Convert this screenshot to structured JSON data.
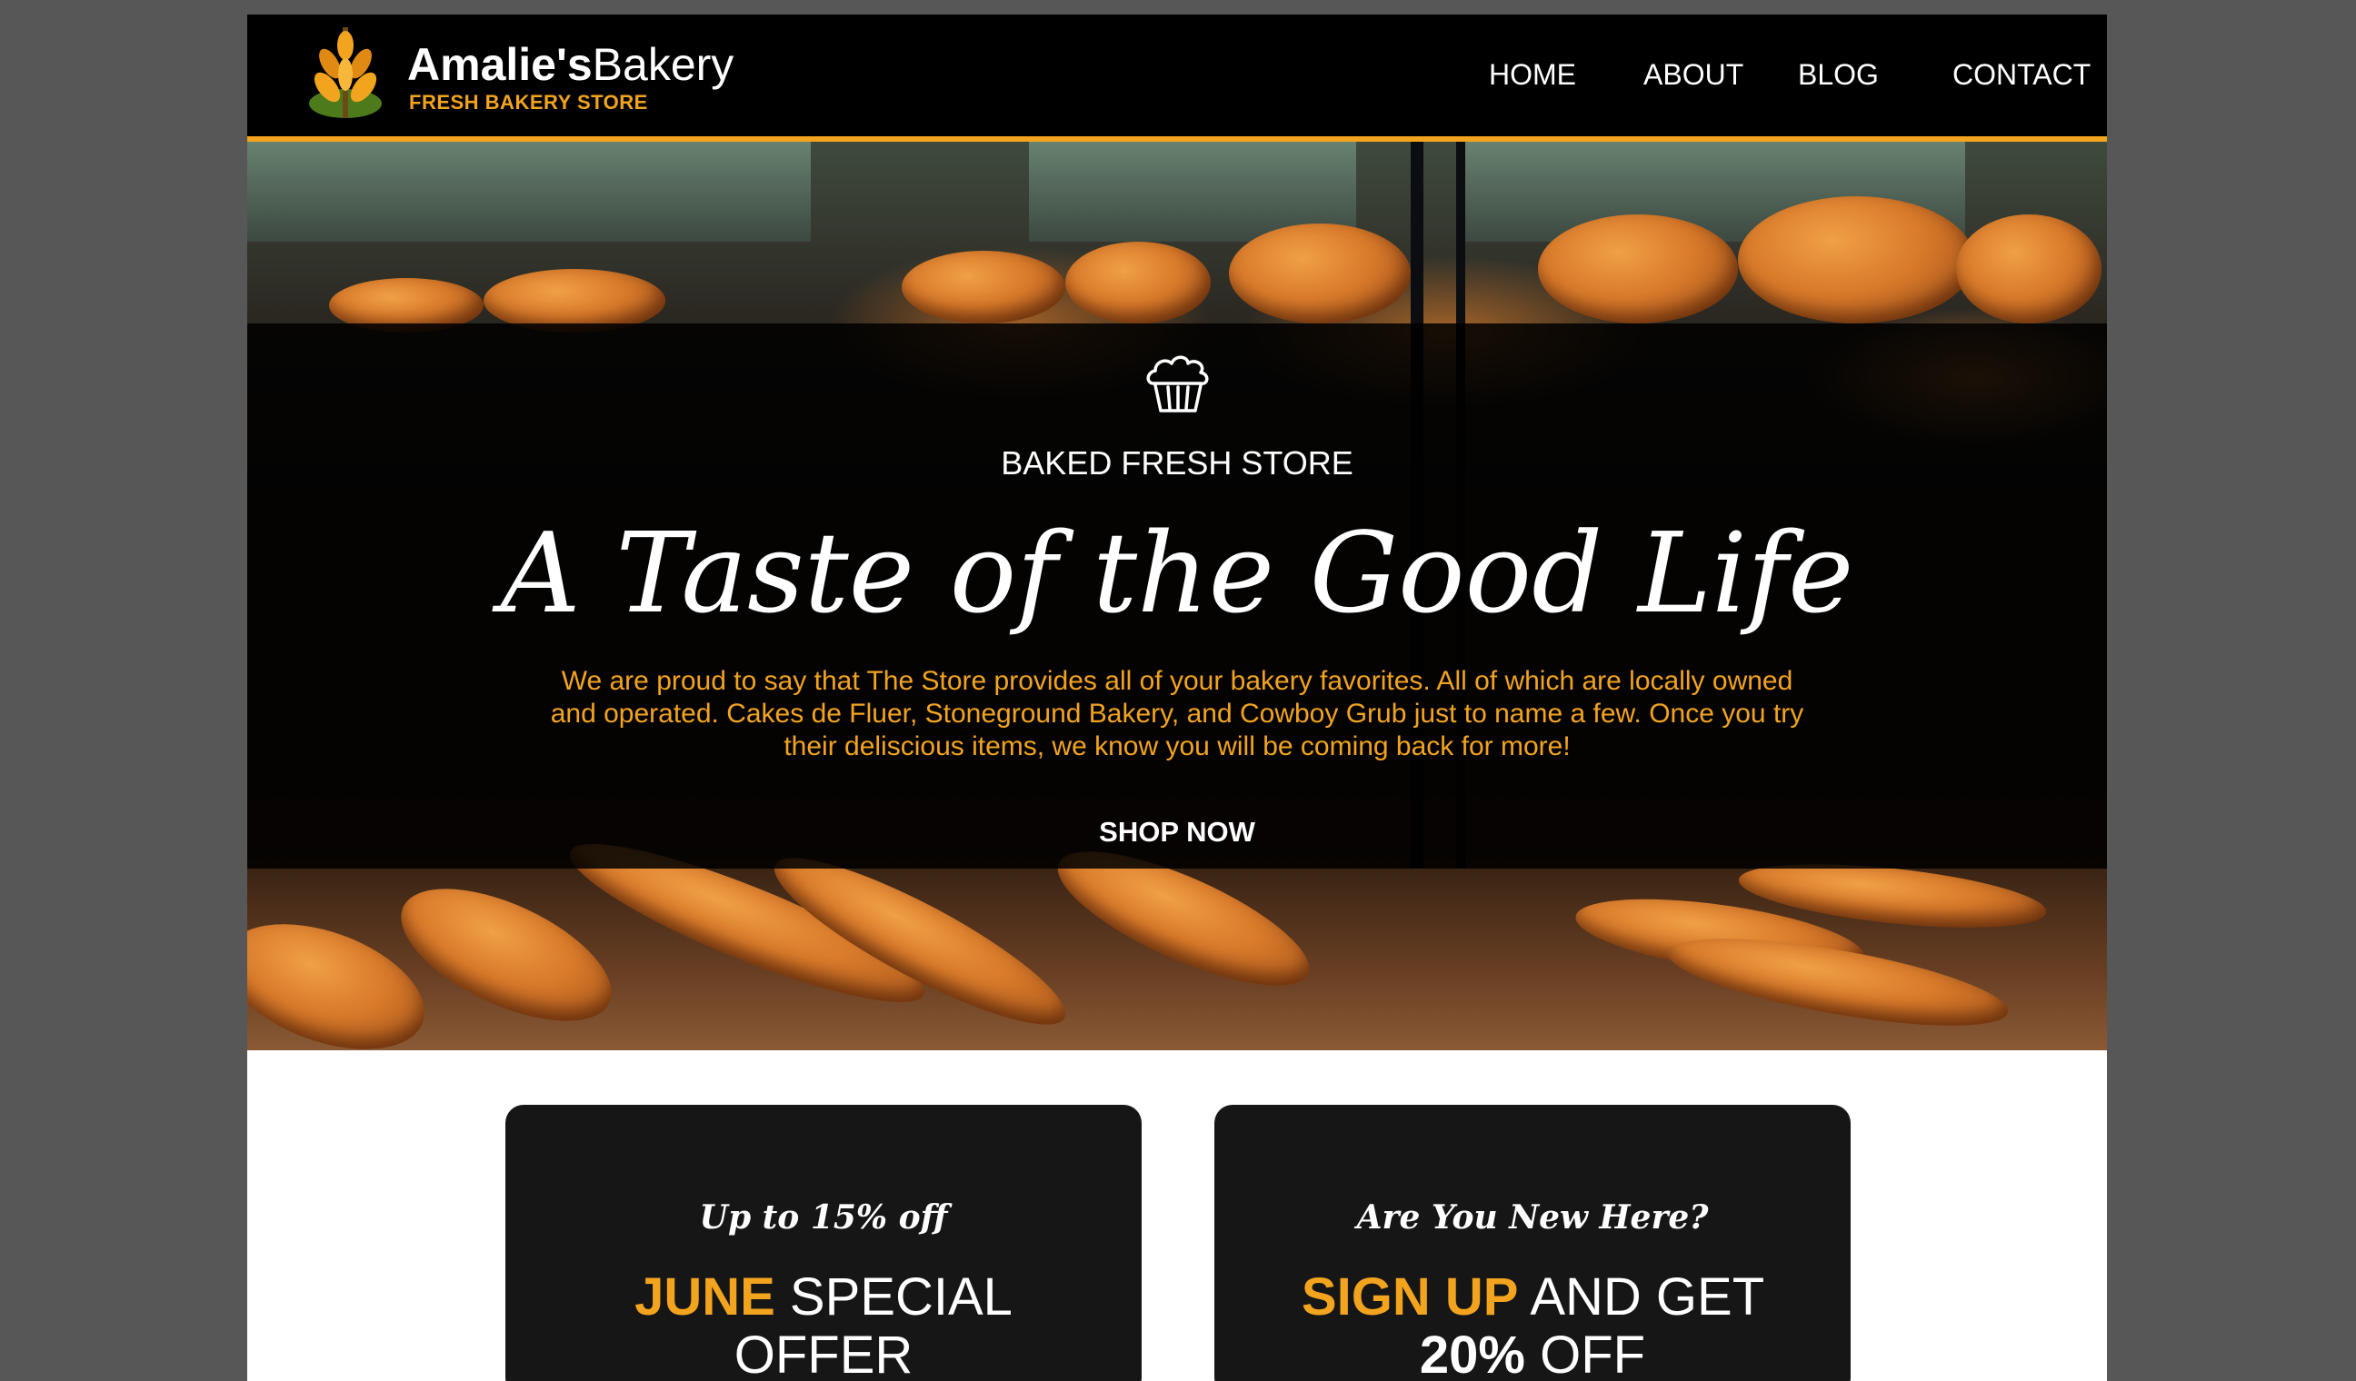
{
  "brand": {
    "name_bold": "Amalie's",
    "name_regular": "Bakery",
    "tagline": "FRESH BAKERY STORE",
    "logo_icon": "wheat-icon"
  },
  "nav": {
    "items": [
      {
        "label": "HOME"
      },
      {
        "label": "ABOUT"
      },
      {
        "label": "BLOG"
      },
      {
        "label": "CONTACT"
      }
    ]
  },
  "hero": {
    "icon": "muffin-icon",
    "kicker": "BAKED FRESH STORE",
    "title": "A Taste of the Good Life",
    "text": "We are proud to say that The Store provides all of your bakery favorites. All of which are locally owned and operated. Cakes de Fluer, Stoneground Bakery, and Cowboy Grub just to name a few. Once you try their deliscious items, we know you will be coming back for more!",
    "cta": "SHOP NOW"
  },
  "cards": [
    {
      "kicker": "Up to 15% off",
      "highlight": "JUNE",
      "rest": "SPECIAL OFFER"
    },
    {
      "kicker": "Are You New Here?",
      "highlight": "SIGN UP",
      "middle": "AND GET",
      "strong": "20%",
      "rest": "OFF"
    }
  ],
  "colors": {
    "accent": "#f2a41f",
    "header_bg": "#000000",
    "card_bg": "#161616",
    "outer_bg": "#575757"
  }
}
